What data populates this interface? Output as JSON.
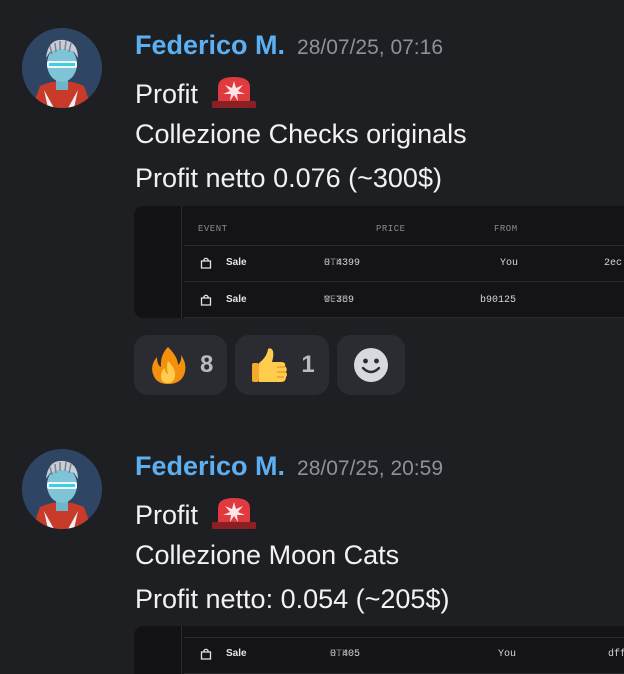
{
  "messages": [
    {
      "author": "Federico M.",
      "timestamp": "28/07/25, 07:16",
      "lines": [
        "Profit",
        "Collezione Checks originals",
        "Profit netto 0.076 (~300$)"
      ],
      "table": {
        "headers": [
          "EVENT",
          "PRICE",
          "FROM"
        ],
        "rows": [
          {
            "event": "Sale",
            "price": "0.4399",
            "unit": "ETH",
            "from": "You",
            "to": "2ec"
          },
          {
            "event": "Sale",
            "price": "0.369",
            "unit": "WETH",
            "from": "b90125",
            "to": ""
          }
        ]
      },
      "reactions": [
        {
          "emoji": "fire-icon",
          "count": "8"
        },
        {
          "emoji": "thumbs-up-icon",
          "count": "1"
        }
      ]
    },
    {
      "author": "Federico M.",
      "timestamp": "28/07/25, 20:59",
      "lines": [
        "Profit",
        "Collezione Moon Cats",
        "Profit netto: 0.054 (~205$)"
      ],
      "table": {
        "rows": [
          {
            "event": "Sale",
            "price": "0.405",
            "unit": "ETH",
            "from": "You",
            "to": "dff"
          }
        ]
      }
    }
  ],
  "colors": {
    "author": "#5cb0f2",
    "background": "#1e1f23",
    "siren": "#e03a3e"
  }
}
